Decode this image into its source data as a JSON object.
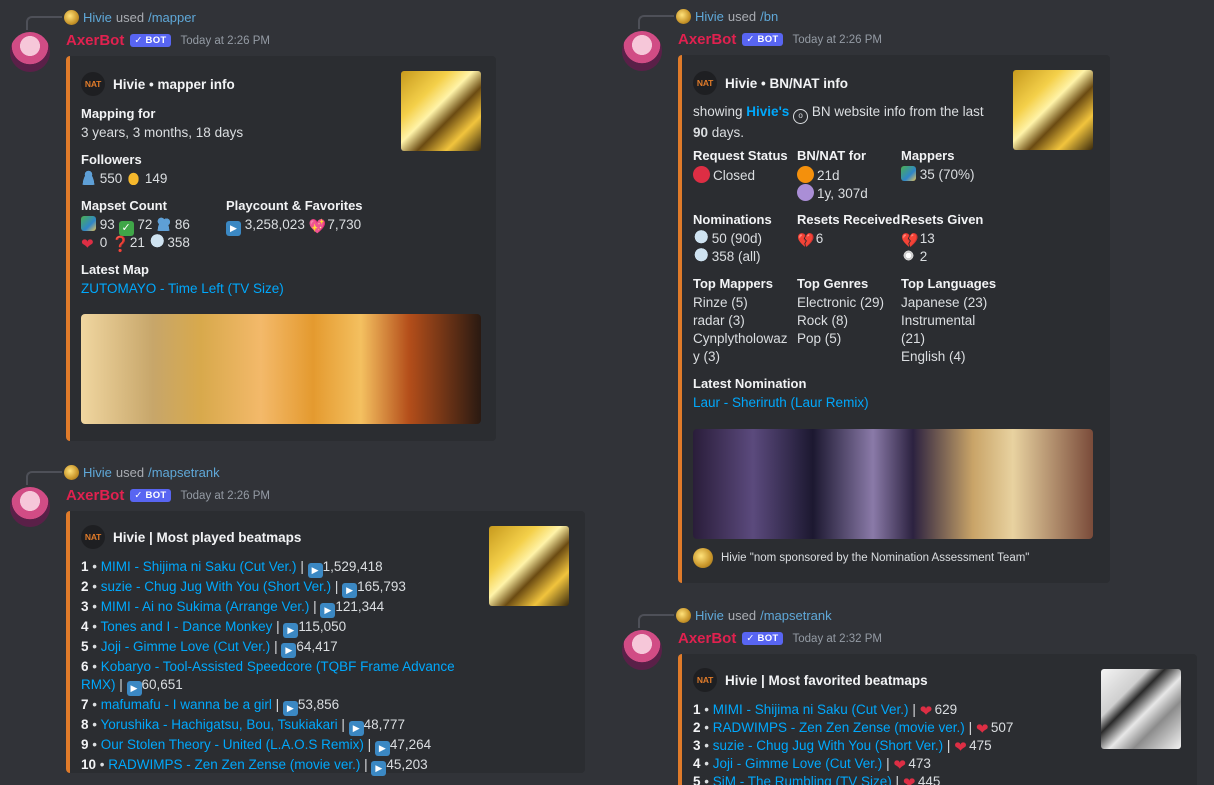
{
  "m1": {
    "reply": {
      "user": "Hivie",
      "used": "used",
      "command": "/mapper"
    },
    "bot": {
      "name": "AxerBot",
      "badge": "✓ BOT",
      "time": "Today at 2:26 PM"
    },
    "author": {
      "badge": "NAT",
      "title": "Hivie • mapper info"
    },
    "fields": {
      "mapping_for": {
        "name": "Mapping for",
        "value": "3 years, 3 months, 18 days"
      },
      "followers": {
        "name": "Followers",
        "followers": "550",
        "subscribers": "149"
      },
      "mapset_count": {
        "name": "Mapset Count",
        "pending": "93",
        "ranked": "72",
        "guest": "86",
        "loved": "0",
        "graveyard": "21",
        "nominated": "358"
      },
      "playcount": {
        "name": "Playcount & Favorites",
        "plays": "3,258,023",
        "favorites": "7,730"
      },
      "latest_map": {
        "name": "Latest Map",
        "value": "ZUTOMAYO - Time Left (TV Size)"
      }
    }
  },
  "m2": {
    "reply": {
      "user": "Hivie",
      "used": "used",
      "command": "/mapsetrank"
    },
    "bot": {
      "name": "AxerBot",
      "badge": "✓ BOT",
      "time": "Today at 2:26 PM"
    },
    "author": {
      "badge": "NAT",
      "title": "Hivie | Most played beatmaps"
    },
    "items": [
      {
        "n": "1",
        "title": "MIMI - Shijima ni Saku (Cut Ver.)",
        "count": "1,529,418"
      },
      {
        "n": "2",
        "title": "suzie - Chug Jug With You (Short Ver.)",
        "count": "165,793"
      },
      {
        "n": "3",
        "title": "MIMI - Ai no Sukima (Arrange Ver.)",
        "count": "121,344"
      },
      {
        "n": "4",
        "title": "Tones and I - Dance Monkey",
        "count": "115,050"
      },
      {
        "n": "5",
        "title": "Joji - Gimme Love (Cut Ver.)",
        "count": "64,417"
      },
      {
        "n": "6",
        "title": "Kobaryo - Tool-Assisted Speedcore (TQBF Frame Advance RMX)",
        "count": "60,651"
      },
      {
        "n": "7",
        "title": "mafumafu - I wanna be a girl",
        "count": "53,856"
      },
      {
        "n": "8",
        "title": "Yorushika - Hachigatsu, Bou, Tsukiakari",
        "count": "48,777"
      },
      {
        "n": "9",
        "title": "Our Stolen Theory - United (L.A.O.S Remix)",
        "count": "47,264"
      },
      {
        "n": "10",
        "title": "RADWIMPS - Zen Zen Zense (movie ver.)",
        "count": "45,203"
      }
    ]
  },
  "m3": {
    "reply": {
      "user": "Hivie",
      "used": "used",
      "command": "/bn"
    },
    "bot": {
      "name": "AxerBot",
      "badge": "✓ BOT",
      "time": "Today at 2:26 PM"
    },
    "author": {
      "badge": "NAT",
      "title": "Hivie • BN/NAT info"
    },
    "desc": {
      "pre": "showing ",
      "user": "Hivie's",
      "mid": " BN website info from the last ",
      "days": "90",
      "post": " days."
    },
    "osu_glyph": "o",
    "fields": {
      "request_status": {
        "name": "Request Status",
        "value": "Closed"
      },
      "bnnat_for": {
        "name": "BN/NAT for",
        "bn": "21d",
        "nat": "1y, 307d"
      },
      "mappers": {
        "name": "Mappers",
        "value": "35 (70%)"
      },
      "nominations": {
        "name": "Nominations",
        "v90": "50 (90d)",
        "all": "358 (all)"
      },
      "resets_received": {
        "name": "Resets Received",
        "value": "6"
      },
      "resets_given": {
        "name": "Resets Given",
        "pops": "13",
        "dqs": "2"
      },
      "top_mappers": {
        "name": "Top Mappers",
        "lines": [
          "Rinze (5)",
          "radar (3)",
          "Cynplytholowaz",
          "y (3)"
        ]
      },
      "top_genres": {
        "name": "Top Genres",
        "lines": [
          "Electronic (29)",
          "Rock (8)",
          "Pop (5)"
        ]
      },
      "top_languages": {
        "name": "Top Languages",
        "lines": [
          "Japanese (23)",
          "Instrumental",
          "(21)",
          "English (4)"
        ]
      },
      "latest_nomination": {
        "name": "Latest Nomination",
        "value": "Laur - Sheriruth (Laur Remix)"
      }
    },
    "footer": "Hivie \"nom sponsored by the Nomination Assessment Team\""
  },
  "m4": {
    "reply": {
      "user": "Hivie",
      "used": "used",
      "command": "/mapsetrank"
    },
    "bot": {
      "name": "AxerBot",
      "badge": "✓ BOT",
      "time": "Today at 2:32 PM"
    },
    "author": {
      "badge": "NAT",
      "title": "Hivie | Most favorited beatmaps"
    },
    "items": [
      {
        "n": "1",
        "title": "MIMI - Shijima ni Saku (Cut Ver.)",
        "count": "629"
      },
      {
        "n": "2",
        "title": "RADWIMPS - Zen Zen Zense (movie ver.)",
        "count": "507"
      },
      {
        "n": "3",
        "title": "suzie - Chug Jug With You (Short Ver.)",
        "count": "475"
      },
      {
        "n": "4",
        "title": "Joji - Gimme Love (Cut Ver.)",
        "count": "473"
      },
      {
        "n": "5",
        "title": "SiM - The Rumbling (TV Size)",
        "count": "445"
      }
    ]
  },
  "icons": {
    "play": "▶",
    "heart": "❤",
    "question": "❓",
    "check": "✓",
    "broken_heart": "💔",
    "hearts": "💖"
  }
}
